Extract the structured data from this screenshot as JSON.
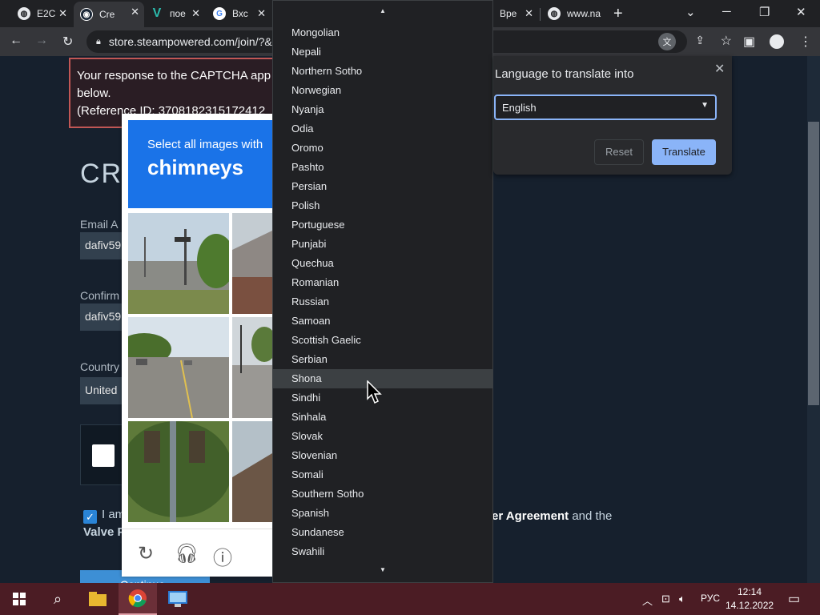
{
  "browser": {
    "tabs": [
      {
        "label": "E2C",
        "fav_letter": "",
        "fav_color": "#e8eaed"
      },
      {
        "label": "Cre",
        "fav_letter": "",
        "fav_color": "#1b2838"
      },
      {
        "label": "пое",
        "fav_letter": "V",
        "fav_color": "#2bbbad"
      },
      {
        "label": "Вхс",
        "fav_letter": "G",
        "fav_color": "#ffffff"
      },
      {
        "label": "Вре",
        "fav_letter": "",
        "fav_color": "#e8eaed"
      },
      {
        "label": "www.na",
        "fav_letter": "",
        "fav_color": "#e8eaed"
      }
    ],
    "url": "store.steampowered.com/join/?&"
  },
  "steam": {
    "error_lines": [
      "Your response to the CAPTCHA app",
      "below.",
      "(Reference ID: 3708182315172412"
    ],
    "create_title": "CRI",
    "email_label": "Email A",
    "email_value": "dafiv59",
    "confirm_label": "Confirm",
    "confirm_value": "dafiv59",
    "country_label": "Country",
    "country_value": "United",
    "agree_text": "I am",
    "valve_text": "Valve Pr",
    "agreement_bold": "er Agreement",
    "agreement_tail": " and the",
    "continue_label": "Continue"
  },
  "recaptcha": {
    "instruction": "Select all images with",
    "target": "chimneys"
  },
  "language_list": {
    "items": [
      "Mongolian",
      "Nepali",
      "Northern Sotho",
      "Norwegian",
      "Nyanja",
      "Odia",
      "Oromo",
      "Pashto",
      "Persian",
      "Polish",
      "Portuguese",
      "Punjabi",
      "Quechua",
      "Romanian",
      "Russian",
      "Samoan",
      "Scottish Gaelic",
      "Serbian",
      "Shona",
      "Sindhi",
      "Sinhala",
      "Slovak",
      "Slovenian",
      "Somali",
      "Southern Sotho",
      "Spanish",
      "Sundanese",
      "Swahili"
    ],
    "highlighted": "Shona"
  },
  "translate_bubble": {
    "title": "Language to translate into",
    "selected": "English",
    "reset_label": "Reset",
    "translate_label": "Translate"
  },
  "taskbar": {
    "lang": "РУС",
    "time": "12:14",
    "date": "14.12.2022"
  }
}
